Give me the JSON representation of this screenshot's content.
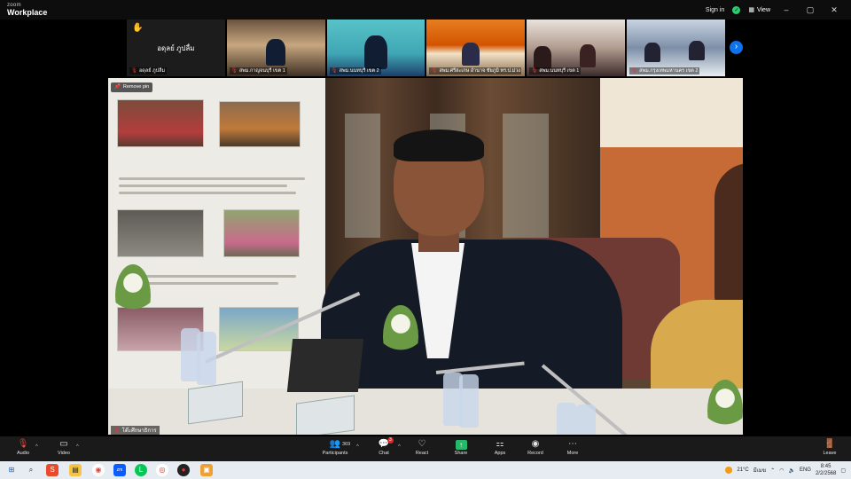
{
  "app": {
    "brand_small": "zoom",
    "brand_big": "Workplace",
    "sign_in": "Sign in",
    "view": "View",
    "window_controls": [
      "–",
      "▢",
      "✕"
    ]
  },
  "gallery": {
    "tiles": [
      {
        "name": "อดุลย์ ภูปลื่ม",
        "type": "avatar",
        "center_name": "อดุลย์ ภูปลื่ม"
      },
      {
        "name": "สพม.กาญจนบุรี เขต 1",
        "type": "video"
      },
      {
        "name": "สพม.นนทบุรี เขต 2",
        "type": "video"
      },
      {
        "name": "สพม.ศรีสะเกษ อำนาจ ชัยภูมิ ทร.ป.ม่วง",
        "type": "video"
      },
      {
        "name": "สพม.นนทบุรี เขต 1",
        "type": "video"
      },
      {
        "name": "สพม.กรุงเทพมหานคร เขต 2",
        "type": "video"
      }
    ],
    "next_icon": "chevron-right-icon"
  },
  "main_video": {
    "remove_pin_label": "Remove pin",
    "participant_name": "โต๊ะศึกษาธิการ"
  },
  "toolbar": {
    "audio": "Audio",
    "video": "Video",
    "participants": "Participants",
    "participants_count": "369",
    "chat": "Chat",
    "chat_badge": "3",
    "react": "React",
    "share": "Share",
    "apps": "Apps",
    "record": "Record",
    "more": "More",
    "leave": "Leave"
  },
  "taskbar": {
    "weather": "21°C",
    "weather_desc": "มีเมฆ",
    "time": "8:45",
    "date": "2/2/2568",
    "tray_lang": "ENG"
  },
  "colors": {
    "accent_blue": "#0e72ed",
    "share_green": "#25b86a",
    "muted_red": "#e84d3d"
  }
}
